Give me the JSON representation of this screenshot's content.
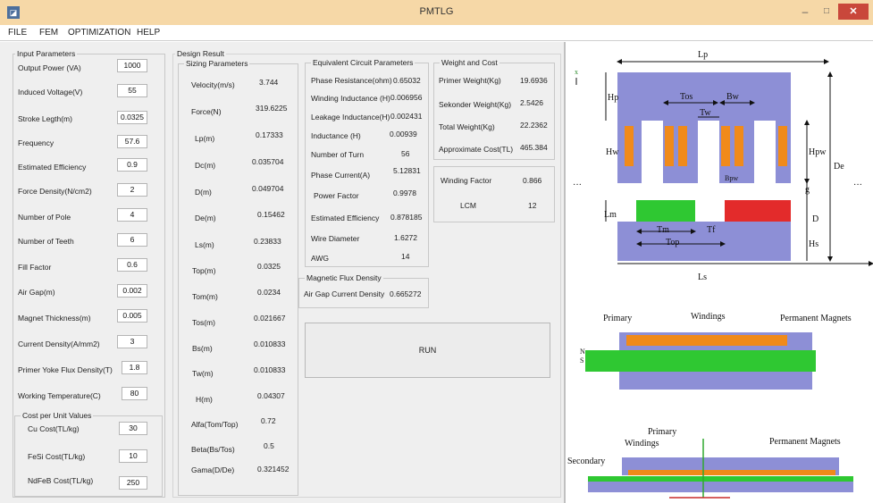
{
  "window": {
    "title": "PMTLG",
    "minimize": "–",
    "maximize": "□",
    "close": "✕",
    "app_icon": "◪"
  },
  "menu": {
    "file": "FILE",
    "fem": "FEM",
    "optimization": "OPTIMIZATION",
    "help": "HELP"
  },
  "input_parameters": {
    "title": "Input Parameters",
    "output_power": {
      "label": "Output Power (VA)",
      "value": "1000"
    },
    "induced_voltage": {
      "label": "Induced Voltage(V)",
      "value": "55"
    },
    "stroke_length": {
      "label": "Stroke Legth(m)",
      "value": "0.0325"
    },
    "frequency": {
      "label": "Frequency",
      "value": "57.6"
    },
    "estimated_efficiency": {
      "label": "Estimated Efficiency",
      "value": "0.9"
    },
    "force_density": {
      "label": "Force Density(N/cm2)",
      "value": "2"
    },
    "number_of_pole": {
      "label": "Number of Pole",
      "value": "4"
    },
    "number_of_teeth": {
      "label": "Number of Teeth",
      "value": "6"
    },
    "fill_factor": {
      "label": "Fill Factor",
      "value": "0.6"
    },
    "air_gap": {
      "label": "Air Gap(m)",
      "value": "0.002"
    },
    "magnet_thickness": {
      "label": "Magnet Thickness(m)",
      "value": "0.005"
    },
    "current_density": {
      "label": "Current Density(A/mm2)",
      "value": "3"
    },
    "primer_yoke_flux": {
      "label": "Primer Yoke Flux  Density(T)",
      "value": "1.8"
    },
    "working_temperature": {
      "label": "Working Temperature(C)",
      "value": "80"
    }
  },
  "cost_per_unit": {
    "title": "Cost per Unit Values",
    "cu": {
      "label": "Cu Cost(TL/kg)",
      "value": "30"
    },
    "fesi": {
      "label": "FeSi Cost(TL/kg)",
      "value": "10"
    },
    "ndfeb": {
      "label": "NdFeB Cost(TL/kg)",
      "value": "250"
    }
  },
  "design_result": {
    "title": "Design Result"
  },
  "sizing": {
    "title": "Sizing Parameters",
    "velocity": {
      "label": "Velocity(m/s)",
      "value": "3.744"
    },
    "force": {
      "label": "Force(N)",
      "value": "319.6225"
    },
    "lp": {
      "label": "Lp(m)",
      "value": "0.17333"
    },
    "dc": {
      "label": "Dc(m)",
      "value": "0.035704"
    },
    "d": {
      "label": "D(m)",
      "value": "0.049704"
    },
    "de": {
      "label": "De(m)",
      "value": "0.15462"
    },
    "ls": {
      "label": "Ls(m)",
      "value": "0.23833"
    },
    "top": {
      "label": "Top(m)",
      "value": "0.0325"
    },
    "tom": {
      "label": "Tom(m)",
      "value": "0.0234"
    },
    "tos": {
      "label": "Tos(m)",
      "value": "0.021667"
    },
    "bs": {
      "label": "Bs(m)",
      "value": "0.010833"
    },
    "tw": {
      "label": "Tw(m)",
      "value": "0.010833"
    },
    "h": {
      "label": "H(m)",
      "value": "0.04307"
    },
    "alfa": {
      "label": "Alfa(Tom/Top)",
      "value": "0.72"
    },
    "beta": {
      "label": "Beta(Bs/Tos)",
      "value": "0.5"
    },
    "gama": {
      "label": "Gama(D/De)",
      "value": "0.321452"
    }
  },
  "equivalent_circuit": {
    "title": "Equivalent Circuit Parameters",
    "phase_resistance": {
      "label": "Phase Resistance(ohm)",
      "value": "0.65032"
    },
    "winding_inductance": {
      "label": "Winding Inductance (H)",
      "value": "0.006956"
    },
    "leakage_inductance": {
      "label": "Leakage Inductance(H)",
      "value": "0.002431"
    },
    "inductance": {
      "label": "Inductance (H)",
      "value": "0.00939"
    },
    "number_of_turn": {
      "label": "Number of Turn",
      "value": "56"
    },
    "phase_current": {
      "label": "Phase Current(A)",
      "value": "5.12831"
    },
    "power_factor": {
      "label": "Power Factor",
      "value": "0.9978"
    },
    "estimated_efficiency": {
      "label": "Estimated Efficiency",
      "value": "0.878185"
    },
    "wire_diameter": {
      "label": "Wire Diameter",
      "value": "1.6272"
    },
    "awg": {
      "label": "AWG",
      "value": "14"
    }
  },
  "weight_cost": {
    "title": "Weight and Cost",
    "primer_weight": {
      "label": "Primer Weight(Kg)",
      "value": "19.6936"
    },
    "sekonder_weight": {
      "label": "Sekonder Weight(Kg)",
      "value": "2.5426"
    },
    "total_weight": {
      "label": "Total Weight(Kg)",
      "value": "22.2362"
    },
    "approximate_cost": {
      "label": "Approximate Cost(TL)",
      "value": "465.384"
    }
  },
  "winding": {
    "winding_factor": {
      "label": "Winding Factor",
      "value": "0.866"
    },
    "lcm": {
      "label": "LCM",
      "value": "12"
    }
  },
  "magnetic_flux": {
    "title": "Magnetic Flux Density",
    "air_gap_current_density": {
      "label": "Air Gap Current Density",
      "value": "0.665272"
    }
  },
  "run_label": "RUN",
  "figure": {
    "lp": "Lp",
    "hp": "Hp",
    "tos": "Tos",
    "bw": "Bw",
    "tw": "Tw",
    "hw": "Hw",
    "hpw": "Hpw",
    "bpw": "Bpw",
    "de": "De",
    "g": "g",
    "lm": "Lm",
    "d": "D",
    "tm": "Tm",
    "tf": "Tf",
    "top": "Top",
    "hs": "Hs",
    "ls": "Ls",
    "x": "x",
    "dots": "···",
    "primary": "Primary",
    "windings": "Windings",
    "permanent_magnets": "Permanent Magnets",
    "secondary": "Secondary",
    "n": "N",
    "s": "S"
  },
  "colors": {
    "title_bar": "#f6d8a7",
    "close_button": "#c9473b",
    "core": "#8d8fd6",
    "winding": "#f08a1a",
    "magnet_n": "#2fc832",
    "magnet_s": "#e32b2b"
  }
}
